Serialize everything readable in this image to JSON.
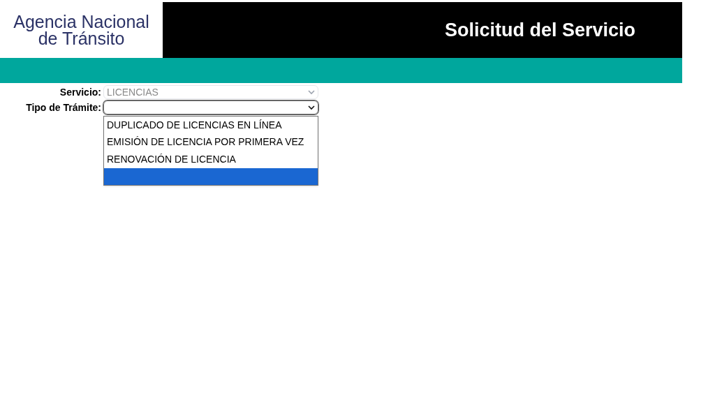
{
  "header": {
    "logo_text": [
      "Agencia Nacional",
      "de Tránsito"
    ],
    "title": "Solicitud del Servicio"
  },
  "form": {
    "fields": [
      {
        "label": "Servicio:",
        "value": "LICENCIAS",
        "disabled": true,
        "open": false
      },
      {
        "label": "Tipo de Trámite:",
        "disabled": false,
        "open": true,
        "options": [
          {
            "label": "DUPLICADO DE LICENCIAS EN LÍNEA",
            "selected": false
          },
          {
            "label": "EMISIÓN DE LICENCIA POR PRIMERA VEZ",
            "selected": false
          },
          {
            "label": "RENOVACIÓN DE LICENCIA",
            "selected": false
          },
          {
            "selected": true
          }
        ]
      }
    ]
  }
}
